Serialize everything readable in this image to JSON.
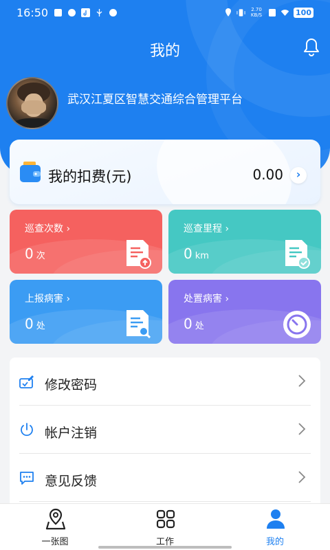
{
  "status_bar": {
    "time": "16:50",
    "network_speed_value": "2.70",
    "network_speed_unit": "KB/S",
    "battery": "100"
  },
  "header": {
    "title": "我的"
  },
  "profile": {
    "organization": "武汉江夏区智慧交通综合管理平台"
  },
  "fee": {
    "label": "我的扣费(元)",
    "value": "0.00"
  },
  "stats": [
    {
      "title": "巡查次数 ›",
      "value": "0",
      "unit": "次",
      "color": "#f5615f",
      "icon": "document-upload-icon"
    },
    {
      "title": "巡查里程 ›",
      "value": "0",
      "unit": "km",
      "color": "#45c8c3",
      "icon": "document-check-icon"
    },
    {
      "title": "上报病害 ›",
      "value": "0",
      "unit": "处",
      "color": "#3b9cf3",
      "icon": "document-search-icon"
    },
    {
      "title": "处置病害 ›",
      "value": "0",
      "unit": "处",
      "color": "#8875ee",
      "icon": "timer-icon"
    }
  ],
  "menu": [
    {
      "label": "修改密码",
      "icon": "edit-password-icon"
    },
    {
      "label": "帐户注销",
      "icon": "power-icon"
    },
    {
      "label": "意见反馈",
      "icon": "feedback-icon"
    }
  ],
  "tabs": [
    {
      "label": "一张图",
      "icon": "map-pin-icon",
      "active": false
    },
    {
      "label": "工作",
      "icon": "grid-icon",
      "active": false
    },
    {
      "label": "我的",
      "icon": "user-icon",
      "active": true
    }
  ],
  "colors": {
    "primary": "#1e80f0"
  }
}
